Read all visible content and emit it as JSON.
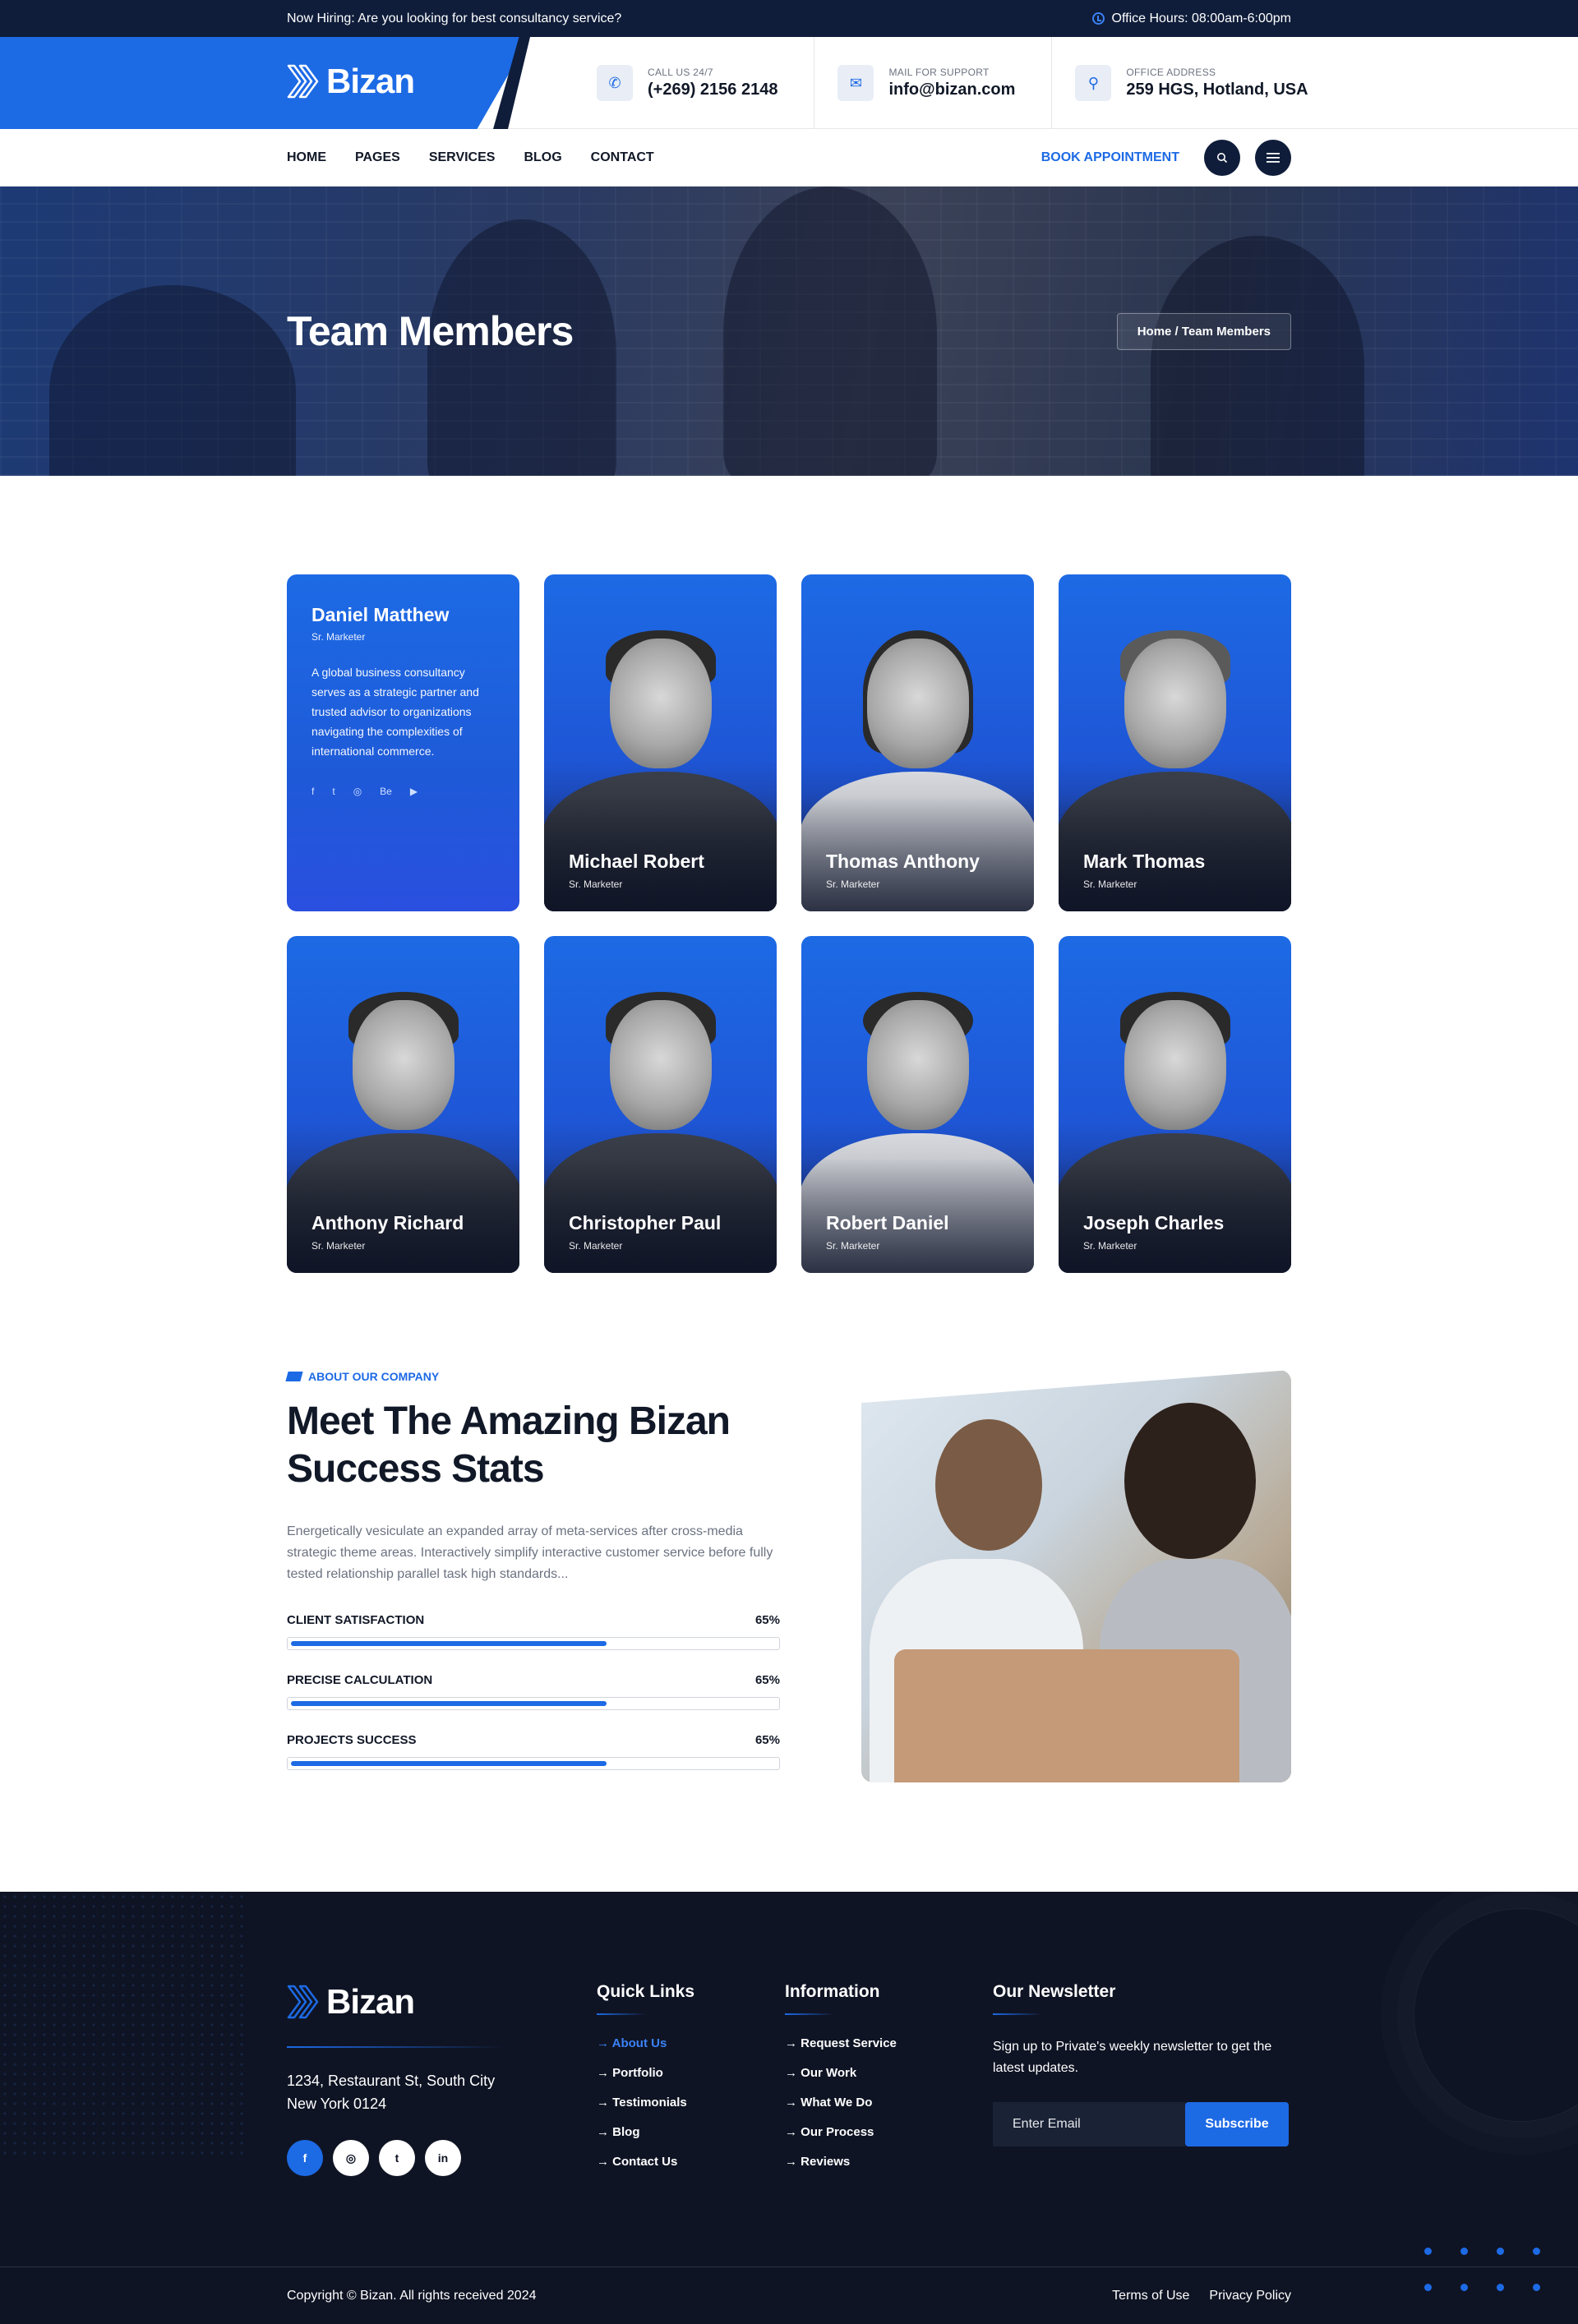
{
  "topbar": {
    "hiring": "Now Hiring: Are you looking for best consultancy service?",
    "hours": "Office Hours: 08:00am-6:00pm"
  },
  "header": {
    "logo": "Bizan",
    "contacts": [
      {
        "label": "CALL US 24/7",
        "value": "(+269) 2156 2148",
        "icon": "phone-icon"
      },
      {
        "label": "MAIL FOR SUPPORT",
        "value": "info@bizan.com",
        "icon": "mail-icon"
      },
      {
        "label": "OFFICE ADDRESS",
        "value": "259 HGS, Hotland, USA",
        "icon": "location-icon"
      }
    ]
  },
  "nav": {
    "items": [
      "HOME",
      "PAGES",
      "SERVICES",
      "BLOG",
      "CONTACT"
    ],
    "cta": "BOOK APPOINTMENT"
  },
  "hero": {
    "title": "Team Members",
    "breadcrumb": "Home / Team Members"
  },
  "team": {
    "featured": {
      "name": "Daniel Matthew",
      "role": "Sr. Marketer",
      "bio": "A global business consultancy serves as a strategic partner and trusted advisor to organizations navigating the complexities of international commerce.",
      "socials": [
        "f",
        "t",
        "◎",
        "Be",
        "▶"
      ]
    },
    "members": [
      {
        "name": "Michael Robert",
        "role": "Sr. Marketer"
      },
      {
        "name": "Thomas Anthony",
        "role": "Sr. Marketer"
      },
      {
        "name": "Mark Thomas",
        "role": "Sr. Marketer"
      },
      {
        "name": "Anthony Richard",
        "role": "Sr. Marketer"
      },
      {
        "name": "Christopher Paul",
        "role": "Sr. Marketer"
      },
      {
        "name": "Robert Daniel",
        "role": "Sr. Marketer"
      },
      {
        "name": "Joseph Charles",
        "role": "Sr. Marketer"
      }
    ]
  },
  "about": {
    "tagline": "ABOUT OUR COMPANY",
    "title": "Meet The Amazing Bizan Success Stats",
    "description": "Energetically vesiculate an expanded array of meta-services after cross-media strategic theme areas. Interactively simplify interactive customer service before fully tested relationship parallel task high standards...",
    "stats": [
      {
        "label": "CLIENT SATISFACTION",
        "value": "65%",
        "percent": 65
      },
      {
        "label": "PRECISE CALCULATION",
        "value": "65%",
        "percent": 65
      },
      {
        "label": "PROJECTS SUCCESS",
        "value": "65%",
        "percent": 65
      }
    ]
  },
  "footer": {
    "logo": "Bizan",
    "address_line1": "1234, Restaurant St, South City",
    "address_line2": "New York 0124",
    "socials": [
      "f",
      "◎",
      "t",
      "in"
    ],
    "quick_links": {
      "title": "Quick Links",
      "items": [
        "About Us",
        "Portfolio",
        "Testimonials",
        "Blog",
        "Contact Us"
      ]
    },
    "information": {
      "title": "Information",
      "items": [
        "Request Service",
        "Our Work",
        "What We Do",
        "Our Process",
        "Reviews"
      ]
    },
    "newsletter": {
      "title": "Our Newsletter",
      "text": "Sign up to Private's weekly newsletter to get the latest updates.",
      "placeholder": "Enter Email",
      "button": "Subscribe"
    },
    "copyright": "Copyright © Bizan. All rights received 2024",
    "legal": [
      "Terms of Use",
      "Privacy Policy"
    ]
  },
  "colors": {
    "primary": "#1d6ae5",
    "dark": "#0f1d3a",
    "footer": "#0f1424"
  }
}
